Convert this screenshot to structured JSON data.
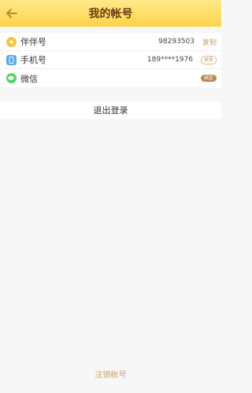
{
  "header": {
    "title": "我的帐号",
    "back_icon": "arrow-left-icon"
  },
  "accounts": [
    {
      "label": "伴伴号",
      "value": "98293503",
      "action": "复制",
      "icon": "coin-icon",
      "color": "#f5c542"
    },
    {
      "label": "手机号",
      "value": "189****1976",
      "action": "更换",
      "icon": "phone-icon",
      "color": "#5aa9e6"
    },
    {
      "label": "微信",
      "value": "",
      "action": "绑定",
      "icon": "wechat-icon",
      "color": "#4cd964"
    }
  ],
  "logout_label": "退出登录",
  "cancel_label": "注销帐号",
  "colors": {
    "accent": "#c9a46b",
    "header": "#ffd44a"
  }
}
